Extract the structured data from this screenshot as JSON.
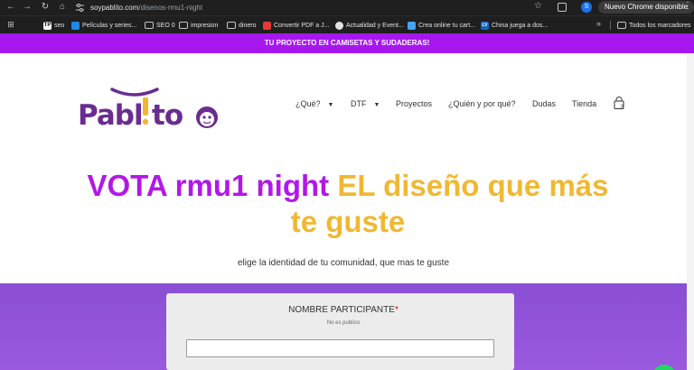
{
  "browser": {
    "url_domain": "soypablito.com",
    "url_path": "/disenos-rmu1-night",
    "profile_initial": "S",
    "update_button": "Nuevo Chrome disponible",
    "bookmarks": [
      {
        "label": "seo",
        "icon": "tp-icon",
        "color": "#ffffff"
      },
      {
        "label": "Películas y series...",
        "icon": "media-icon",
        "color": "#1e88e5"
      },
      {
        "label": "SEO 0",
        "icon": "folder-icon",
        "color": ""
      },
      {
        "label": "impresion",
        "icon": "folder-icon",
        "color": ""
      },
      {
        "label": "dinero",
        "icon": "folder-icon",
        "color": ""
      },
      {
        "label": "Convertir PDF a J...",
        "icon": "pdf-icon",
        "color": "#e53935"
      },
      {
        "label": "Actualidad y Event...",
        "icon": "wordpress-icon",
        "color": "#e3e3e3"
      },
      {
        "label": "Crea online tu cart...",
        "icon": "site-icon",
        "color": "#42a5f5"
      },
      {
        "label": "China juega a dos...",
        "icon": "lv-icon",
        "color": "#1565c0"
      }
    ],
    "all_bookmarks": "Todos los marcadores"
  },
  "promo": {
    "text": "TU PROYECTO EN CAMISETAS Y SUDADERAS!"
  },
  "brand": {
    "logo_text": "Pablito",
    "purple": "#6a2c91",
    "yellow": "#f0b832"
  },
  "menu": {
    "items": [
      {
        "label": "¿Qué?",
        "dropdown": true
      },
      {
        "label": "DTF",
        "dropdown": true
      },
      {
        "label": "Proyectos",
        "dropdown": false
      },
      {
        "label": "¿Quién y por qué?",
        "dropdown": false
      },
      {
        "label": "Dudas",
        "dropdown": false
      },
      {
        "label": "Tienda",
        "dropdown": false
      }
    ],
    "cart_count": "0"
  },
  "hero": {
    "title_part1": "VOTA rmu1 night",
    "title_part2": "EL diseño que más",
    "title_line2": "te guste",
    "subtitle": "elige la identidad de tu comunidad, que mas te guste"
  },
  "form": {
    "label": "NOMBRE PARTICIPANTE",
    "required_mark": "*",
    "help": "No es publico",
    "value": ""
  },
  "colors": {
    "accent": "#a617ee",
    "title_purple": "#b217e8",
    "title_yellow": "#f0b832",
    "form_bg": "#8a4fd4"
  }
}
